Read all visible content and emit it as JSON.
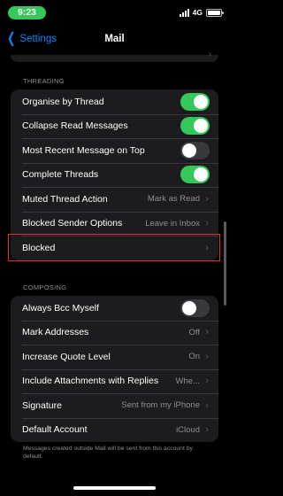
{
  "status_bar": {
    "time": "9:23",
    "network": "4G"
  },
  "nav": {
    "back_label": "Settings",
    "title": "Mail"
  },
  "threading": {
    "header": "THREADING",
    "rows": [
      {
        "label": "Organise by Thread",
        "type": "toggle",
        "on": true
      },
      {
        "label": "Collapse Read Messages",
        "type": "toggle",
        "on": true
      },
      {
        "label": "Most Recent Message on Top",
        "type": "toggle",
        "on": false
      },
      {
        "label": "Complete Threads",
        "type": "toggle",
        "on": true
      },
      {
        "label": "Muted Thread Action",
        "type": "link",
        "value": "Mark as Read"
      },
      {
        "label": "Blocked Sender Options",
        "type": "link",
        "value": "Leave in Inbox"
      },
      {
        "label": "Blocked",
        "type": "link",
        "value": ""
      }
    ]
  },
  "composing": {
    "header": "COMPOSING",
    "rows": [
      {
        "label": "Always Bcc Myself",
        "type": "toggle",
        "on": false
      },
      {
        "label": "Mark Addresses",
        "type": "link",
        "value": "Off"
      },
      {
        "label": "Increase Quote Level",
        "type": "link",
        "value": "On"
      },
      {
        "label": "Include Attachments with Replies",
        "type": "link",
        "value": "Whe..."
      },
      {
        "label": "Signature",
        "type": "link",
        "value": "Sent from my iPhone"
      },
      {
        "label": "Default Account",
        "type": "link",
        "value": "iCloud"
      }
    ]
  },
  "footer_note": "Messages created outside Mail will be sent from this account by default.",
  "colors": {
    "accent": "#0a84ff",
    "toggle_on": "#34c759",
    "highlight": "#e0303a",
    "cell_bg": "#1c1c1e"
  },
  "icons": {
    "back": "chevron-left-icon",
    "disclosure": "chevron-right-icon",
    "signal": "signal-icon",
    "battery": "battery-icon"
  }
}
